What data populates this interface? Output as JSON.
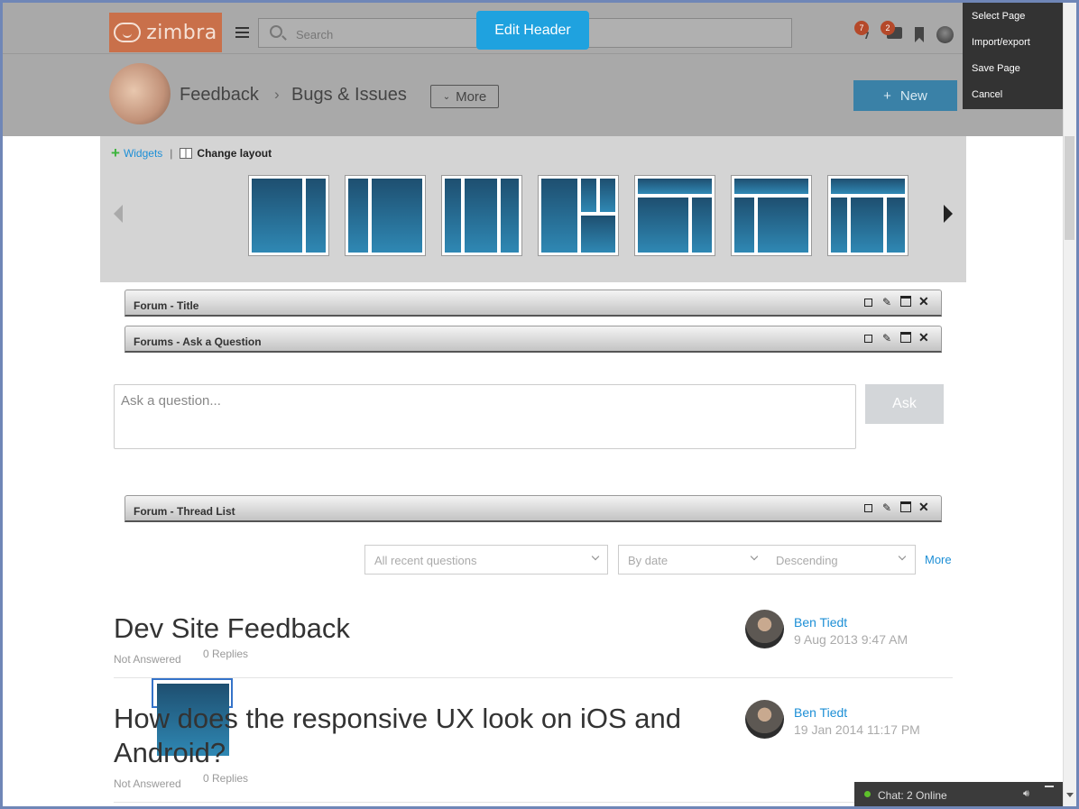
{
  "header": {
    "logo_text": "zimbra",
    "search_placeholder": "Search",
    "edit_header_label": "Edit Header",
    "notifications_badge": "7",
    "messages_badge": "2"
  },
  "edit_menu": {
    "items": [
      "Select Page",
      "Import/export",
      "Save Page",
      "Cancel"
    ]
  },
  "pagebar": {
    "crumb_parent": "Feedback",
    "crumb_separator": "›",
    "crumb_current": "Bugs & Issues",
    "more_label": "More",
    "new_label": "New",
    "new_icon": "+"
  },
  "layout_picker": {
    "widgets_label": "Widgets",
    "change_layout_label": "Change layout",
    "selected_index": 0,
    "layouts": [
      "single",
      "two-col-wide-left",
      "two-col-wide-right",
      "three-col",
      "grid-mixed",
      "header-two-col",
      "header-two-col-alt",
      "header-three-col"
    ]
  },
  "widgets": [
    {
      "title": "Forum - Title"
    },
    {
      "title": "Forums - Ask a Question"
    },
    {
      "title": "Forum - Thread List"
    }
  ],
  "ask": {
    "placeholder": "Ask a question...",
    "button_label": "Ask"
  },
  "filters": {
    "scope": "All recent questions",
    "sort_by": "By date",
    "order": "Descending",
    "more_label": "More"
  },
  "threads": [
    {
      "title": "Dev Site Feedback",
      "status": "Not Answered",
      "replies": "0 Replies",
      "author": "Ben Tiedt",
      "date": "9 Aug 2013 9:47 AM"
    },
    {
      "title": "How does the responsive UX look on iOS and Android?",
      "status": "Not Answered",
      "replies": "0 Replies",
      "author": "Ben Tiedt",
      "date": "19 Jan 2014 11:17 PM"
    }
  ],
  "chat": {
    "label": "Chat: 2 Online"
  },
  "colors": {
    "accent": "#1fa2df",
    "new_button": "#3a81a7",
    "link": "#1d8fd6",
    "online_dot": "#5ec12b"
  }
}
